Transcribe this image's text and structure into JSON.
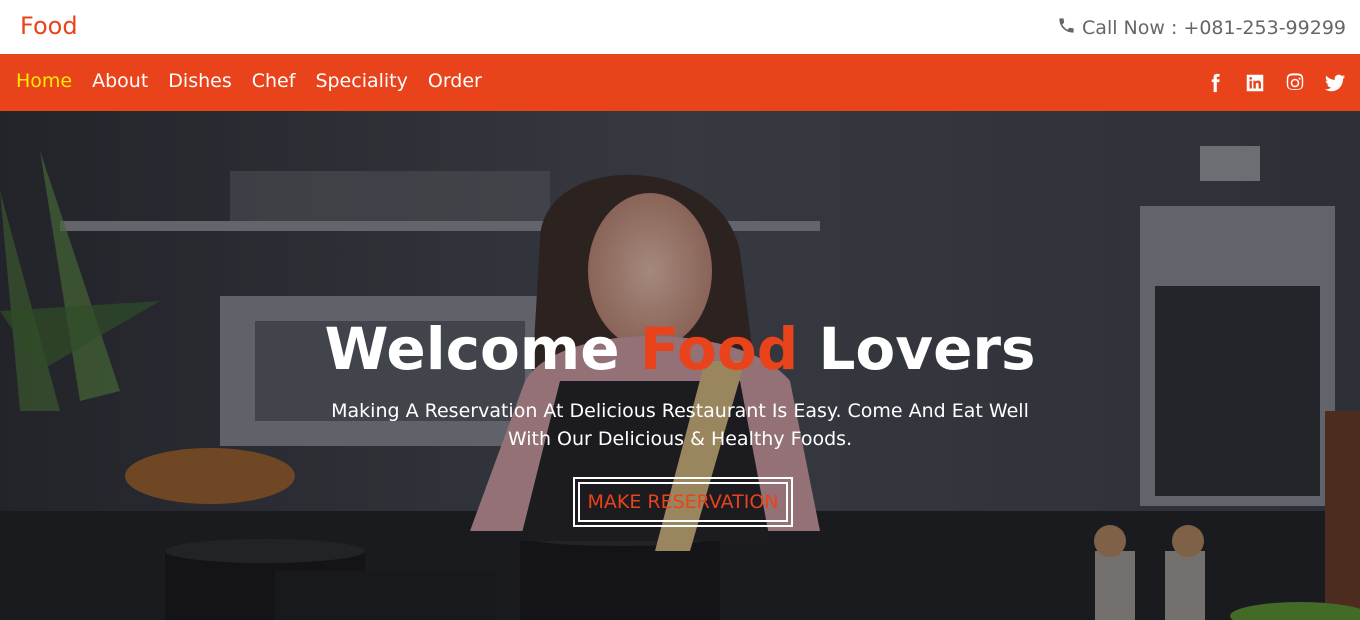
{
  "header": {
    "brand": "Food",
    "call_text": "Call Now : +081-253-99299"
  },
  "nav": {
    "items": [
      {
        "label": "Home",
        "active": true
      },
      {
        "label": "About"
      },
      {
        "label": "Dishes"
      },
      {
        "label": "Chef"
      },
      {
        "label": "Speciality"
      },
      {
        "label": "Order"
      }
    ],
    "social": [
      "facebook-icon",
      "linkedin-icon",
      "instagram-icon",
      "twitter-icon"
    ]
  },
  "hero": {
    "title_pre": "Welcome ",
    "title_accent": "Food",
    "title_post": " Lovers",
    "subtitle_line1": "Making A Reservation At Delicious Restaurant Is Easy. Come And Eat Well",
    "subtitle_line2": "With Our Delicious & Healthy Foods.",
    "cta_label": "MAKE RESERVATION"
  },
  "colors": {
    "accent": "#e8431b",
    "active_nav": "#ffea00"
  }
}
